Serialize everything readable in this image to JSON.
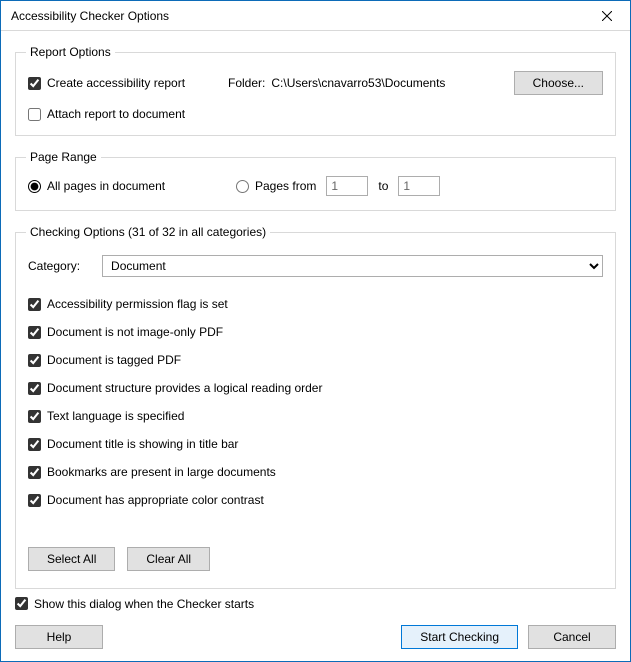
{
  "window": {
    "title": "Accessibility Checker Options"
  },
  "report": {
    "legend": "Report Options",
    "create_label": "Create accessibility report",
    "create_checked": true,
    "folder_label": "Folder:",
    "folder_path": "C:\\Users\\cnavarro53\\Documents",
    "choose_label": "Choose...",
    "attach_label": "Attach report to document",
    "attach_checked": false
  },
  "page_range": {
    "legend": "Page Range",
    "all_label": "All pages in document",
    "from_label": "Pages from",
    "to_label": "to",
    "from_value": "1",
    "to_value": "1",
    "selected": "all"
  },
  "checking": {
    "legend": "Checking Options (31 of 32 in all categories)",
    "category_label": "Category:",
    "category_value": "Document",
    "items": [
      "Accessibility permission flag is set",
      "Document is not image-only PDF",
      "Document is tagged PDF",
      "Document structure provides a logical reading order",
      "Text language is specified",
      "Document title is showing in title bar",
      "Bookmarks are present in large documents",
      "Document has appropriate color contrast"
    ],
    "select_all_label": "Select All",
    "clear_all_label": "Clear All"
  },
  "footer": {
    "show_dialog_label": "Show this dialog when the Checker starts",
    "show_dialog_checked": true,
    "help_label": "Help",
    "start_label": "Start Checking",
    "cancel_label": "Cancel"
  }
}
